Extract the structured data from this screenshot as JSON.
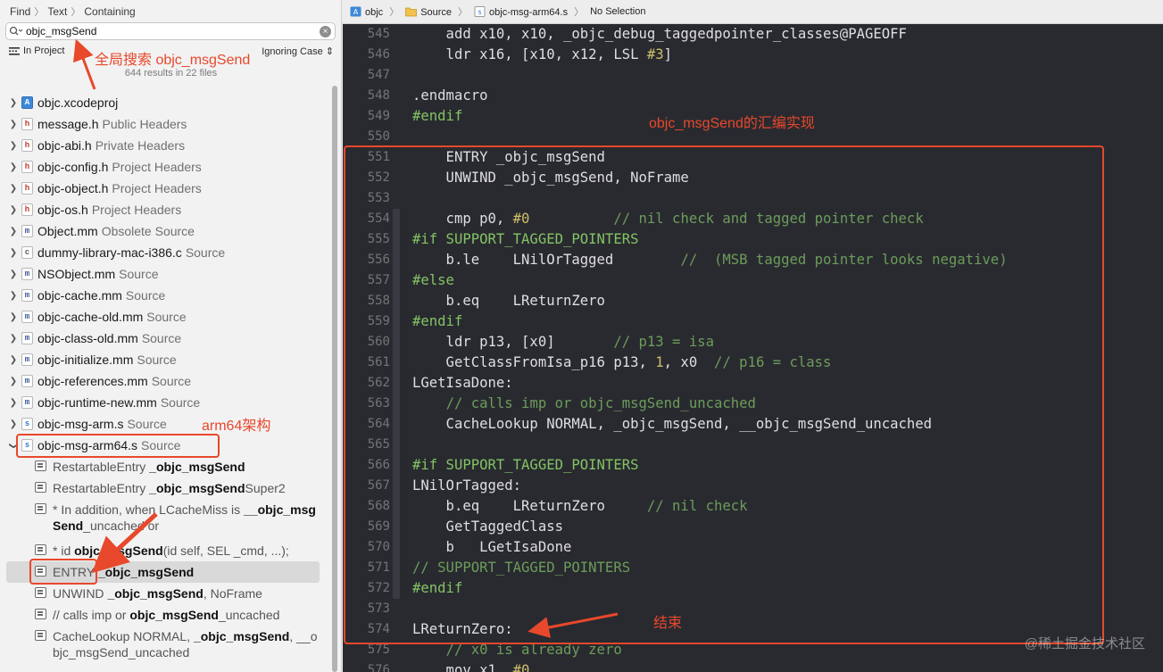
{
  "find_bar": {
    "find": "Find",
    "text": "Text",
    "containing": "Containing"
  },
  "search": {
    "value": "objc_msgSend",
    "placeholder": ""
  },
  "scope": {
    "label": "In Project",
    "case": "Ignoring Case"
  },
  "results_count": "644 results in 22 files",
  "files": [
    {
      "icon": "proj",
      "name": "objc.xcodeproj",
      "kind": ""
    },
    {
      "icon": "h",
      "name": "message.h",
      "kind": "Public Headers"
    },
    {
      "icon": "h",
      "name": "objc-abi.h",
      "kind": "Private Headers"
    },
    {
      "icon": "h",
      "name": "objc-config.h",
      "kind": "Project Headers"
    },
    {
      "icon": "h",
      "name": "objc-object.h",
      "kind": "Project Headers"
    },
    {
      "icon": "h",
      "name": "objc-os.h",
      "kind": "Project Headers"
    },
    {
      "icon": "m",
      "name": "Object.mm",
      "kind": "Obsolete Source"
    },
    {
      "icon": "c",
      "name": "dummy-library-mac-i386.c",
      "kind": "Source"
    },
    {
      "icon": "m",
      "name": "NSObject.mm",
      "kind": "Source"
    },
    {
      "icon": "m",
      "name": "objc-cache.mm",
      "kind": "Source"
    },
    {
      "icon": "m",
      "name": "objc-cache-old.mm",
      "kind": "Source"
    },
    {
      "icon": "m",
      "name": "objc-class-old.mm",
      "kind": "Source"
    },
    {
      "icon": "m",
      "name": "objc-initialize.mm",
      "kind": "Source"
    },
    {
      "icon": "m",
      "name": "objc-references.mm",
      "kind": "Source"
    },
    {
      "icon": "m",
      "name": "objc-runtime-new.mm",
      "kind": "Source"
    },
    {
      "icon": "s",
      "name": "objc-msg-arm.s",
      "kind": "Source"
    }
  ],
  "expanded_file": {
    "icon": "s",
    "name": "objc-msg-arm64.s",
    "kind": "Source"
  },
  "results": [
    {
      "pre": "RestartableEntry ",
      "match": "_objc_msgSend",
      "post": ""
    },
    {
      "pre": "RestartableEntry ",
      "match": "_objc_msgSend",
      "post": "Super2"
    },
    {
      "pre": "*         In addition, when LCacheMiss is ",
      "match": "__objc_msgSend",
      "post": "_uncached or"
    },
    {
      "pre": "* id ",
      "match": "objc_msgSend",
      "post": "(id self, SEL _cmd, ...);"
    },
    {
      "pre": "ENTRY ",
      "match": "_objc_msgSend",
      "post": ""
    },
    {
      "pre": "UNWIND ",
      "match": "_objc_msgSend",
      "post": ", NoFrame"
    },
    {
      "pre": "// calls imp or ",
      "match": "objc_msgSend",
      "post": "_uncached"
    },
    {
      "pre": "CacheLookup NORMAL, ",
      "match": "_objc_msgSend",
      "post": ", __objc_msgSend_uncached"
    }
  ],
  "jumpbar": {
    "project": "objc",
    "folder": "Source",
    "file": "objc-msg-arm64.s",
    "selection": "No Selection"
  },
  "code_lines": [
    {
      "n": "545",
      "t": "    add x10, x10, _objc_debug_taggedpointer_classes@PAGEOFF"
    },
    {
      "n": "546",
      "t": "    ldr x16, [x10, x12, LSL #3]"
    },
    {
      "n": "547",
      "t": ""
    },
    {
      "n": "548",
      "t": ".endmacro"
    },
    {
      "n": "549",
      "t": "#endif"
    },
    {
      "n": "550",
      "t": ""
    },
    {
      "n": "551",
      "t": "    ENTRY _objc_msgSend"
    },
    {
      "n": "552",
      "t": "    UNWIND _objc_msgSend, NoFrame"
    },
    {
      "n": "553",
      "t": ""
    },
    {
      "n": "554",
      "t": "    cmp p0, #0          // nil check and tagged pointer check"
    },
    {
      "n": "555",
      "t": "#if SUPPORT_TAGGED_POINTERS"
    },
    {
      "n": "556",
      "t": "    b.le    LNilOrTagged        //  (MSB tagged pointer looks negative)"
    },
    {
      "n": "557",
      "t": "#else"
    },
    {
      "n": "558",
      "t": "    b.eq    LReturnZero"
    },
    {
      "n": "559",
      "t": "#endif"
    },
    {
      "n": "560",
      "t": "    ldr p13, [x0]       // p13 = isa"
    },
    {
      "n": "561",
      "t": "    GetClassFromIsa_p16 p13, 1, x0  // p16 = class"
    },
    {
      "n": "562",
      "t": "LGetIsaDone:"
    },
    {
      "n": "563",
      "t": "    // calls imp or objc_msgSend_uncached"
    },
    {
      "n": "564",
      "t": "    CacheLookup NORMAL, _objc_msgSend, __objc_msgSend_uncached"
    },
    {
      "n": "565",
      "t": ""
    },
    {
      "n": "566",
      "t": "#if SUPPORT_TAGGED_POINTERS"
    },
    {
      "n": "567",
      "t": "LNilOrTagged:"
    },
    {
      "n": "568",
      "t": "    b.eq    LReturnZero     // nil check"
    },
    {
      "n": "569",
      "t": "    GetTaggedClass"
    },
    {
      "n": "570",
      "t": "    b   LGetIsaDone"
    },
    {
      "n": "571",
      "t": "// SUPPORT_TAGGED_POINTERS"
    },
    {
      "n": "572",
      "t": "#endif"
    },
    {
      "n": "573",
      "t": ""
    },
    {
      "n": "574",
      "t": "LReturnZero:"
    },
    {
      "n": "575",
      "t": "    // x0 is already zero"
    },
    {
      "n": "576",
      "t": "    mov x1, #0"
    }
  ],
  "annotations": {
    "global_search": "全局搜索 objc_msgSend",
    "arm64": "arm64架构",
    "impl": "objc_msgSend的汇编实现",
    "end": "结束"
  },
  "watermark": "@稀土掘金技术社区",
  "colors": {
    "annotation": "#e8482b",
    "editor_bg": "#292a30",
    "comment": "#6c9c5a",
    "preprocessor": "#83c363",
    "number": "#d0bf69"
  }
}
